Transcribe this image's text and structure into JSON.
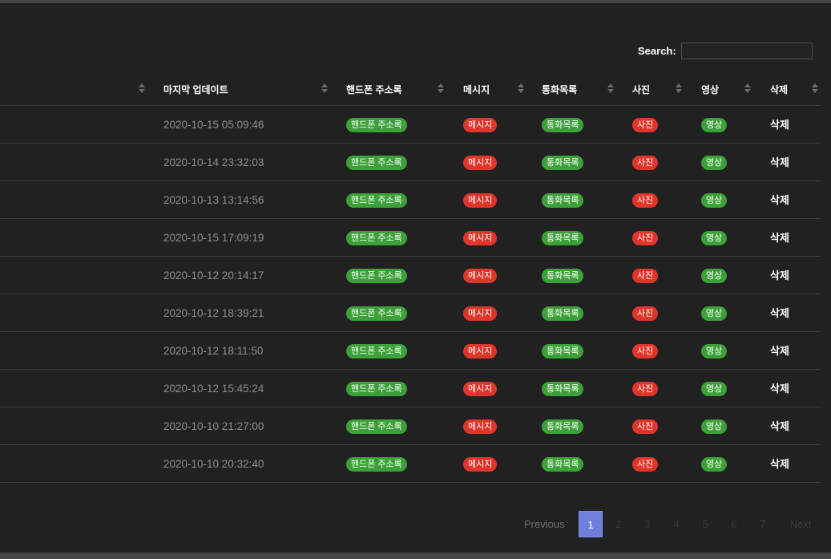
{
  "search": {
    "label": "Search:",
    "value": ""
  },
  "columns": [
    {
      "label": ""
    },
    {
      "label": "마지막 업데이트"
    },
    {
      "label": "핸드폰 주소록"
    },
    {
      "label": "메시지"
    },
    {
      "label": "통화목록"
    },
    {
      "label": "사진"
    },
    {
      "label": "영상"
    },
    {
      "label": "삭제"
    }
  ],
  "badges": {
    "contacts": "핸드폰 주소록",
    "messages": "메시지",
    "calls": "통화목록",
    "photos": "사진",
    "videos": "영상",
    "delete": "삭제"
  },
  "colors": {
    "green": "#3da13a",
    "red": "#e0352b",
    "active_page": "#6f7fdc",
    "background": "#212121"
  },
  "rows": [
    {
      "date": "2020-10-15 05:09:46"
    },
    {
      "date": "2020-10-14 23:32:03"
    },
    {
      "date": "2020-10-13 13:14:56"
    },
    {
      "date": "2020-10-15 17:09:19"
    },
    {
      "date": "2020-10-12 20:14:17"
    },
    {
      "date": "2020-10-12 18:39:21"
    },
    {
      "date": "2020-10-12 18:11:50"
    },
    {
      "date": "2020-10-12 15:45:24"
    },
    {
      "date": "2020-10-10 21:27:00"
    },
    {
      "date": "2020-10-10 20:32:40"
    }
  ],
  "pagination": {
    "previous": "Previous",
    "pages": [
      "1",
      "2",
      "3",
      "4",
      "5",
      "6",
      "7"
    ],
    "current": "1",
    "next": "Next"
  }
}
